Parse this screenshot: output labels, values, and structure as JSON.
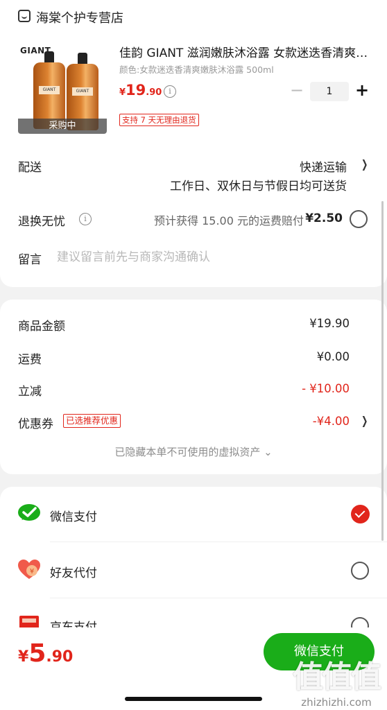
{
  "store": {
    "name": "海棠个护专营店",
    "icon": "store-icon"
  },
  "product": {
    "brand_text": "GIANT",
    "status": "采购中",
    "title": "佳韵 GIANT 滋润嫩肤沐浴露 女款迷迭香清爽嫩肤沐浴露",
    "variant": "颜色:女款迷迭香清爽嫩肤沐浴露 500ml",
    "price_currency": "¥",
    "price_int": "19",
    "price_dec": ".90",
    "quantity": "1",
    "minus": "−",
    "plus": "+",
    "return_policy": "支持 7 天无理由退货"
  },
  "shipping": {
    "label": "配送",
    "method": "快递运输",
    "sub": "工作日、双休日与节假日均可送货"
  },
  "exchange": {
    "label": "退换无忧",
    "desc": "预计获得 15.00 元的运费赔付",
    "price": "¥2.50"
  },
  "message": {
    "label": "留言",
    "placeholder": "建议留言前先与商家沟通确认"
  },
  "summary": {
    "goods_label": "商品金额",
    "goods_value": "¥19.90",
    "freight_label": "运费",
    "freight_value": "¥0.00",
    "discount_label": "立减",
    "discount_value": "- ¥10.00",
    "coupon_label": "优惠券",
    "coupon_badge": "已选推荐优惠",
    "coupon_value": "-¥4.00",
    "hidden_assets": "已隐藏本单不可使用的虚拟资产 ⌄"
  },
  "payment": {
    "methods": [
      {
        "label": "微信支付",
        "icon": "wechat-pay-icon",
        "selected": true
      },
      {
        "label": "好友代付",
        "icon": "friend-pay-icon",
        "selected": false
      },
      {
        "label": "京东支付",
        "icon": "jd-pay-icon",
        "selected": false
      }
    ]
  },
  "footer": {
    "currency": "¥",
    "total_int": "5",
    "total_dec": ".90",
    "pay_button": "微信支付"
  },
  "watermark": {
    "cn": "值值值",
    "en": "zhizhizhi.com"
  },
  "colors": {
    "accent_red": "#e1251b",
    "wechat_green": "#1aad19"
  }
}
